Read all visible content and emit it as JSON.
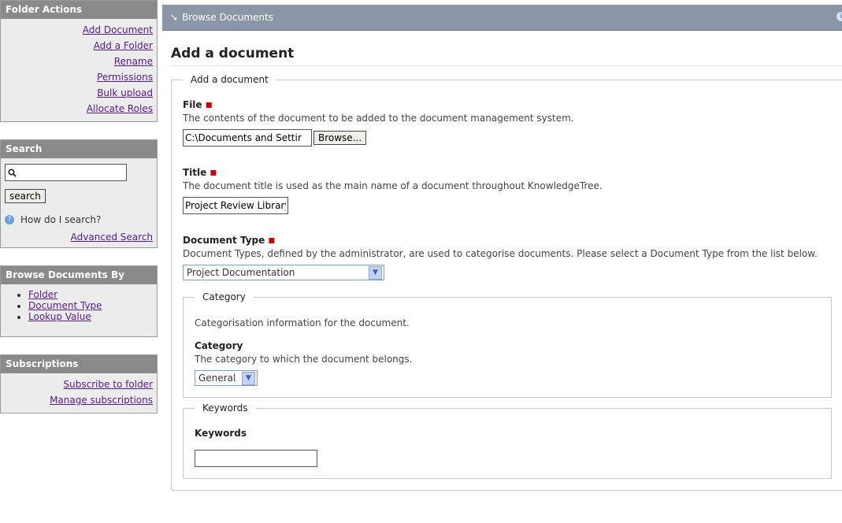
{
  "window": {
    "cut_top_text": "page"
  },
  "sidebar": {
    "folder_actions": {
      "title": "Folder Actions",
      "items": [
        {
          "label": "Add Document"
        },
        {
          "label": "Add a Folder"
        },
        {
          "label": "Rename"
        },
        {
          "label": "Permissions"
        },
        {
          "label": "Bulk upload"
        },
        {
          "label": "Allocate Roles"
        }
      ]
    },
    "search": {
      "title": "Search",
      "input_value": "",
      "button_label": "search",
      "help_text": "How do I search?",
      "advanced_label": "Advanced Search"
    },
    "browse_by": {
      "title": "Browse Documents By",
      "items": [
        {
          "label": "Folder"
        },
        {
          "label": "Document Type"
        },
        {
          "label": "Lookup Value"
        }
      ]
    },
    "subscriptions": {
      "title": "Subscriptions",
      "items": [
        {
          "label": "Subscribe to folder"
        },
        {
          "label": "Manage subscriptions"
        }
      ]
    }
  },
  "header": {
    "breadcrumb": "Browse Documents"
  },
  "main": {
    "page_title": "Add a document",
    "fieldset_legend": "Add a document",
    "file": {
      "label": "File",
      "desc": "The contents of the document to be added to the document management system.",
      "value": "C:\\Documents and Settir",
      "browse_label": "Browse..."
    },
    "title_field": {
      "label": "Title",
      "desc": "The document title is used as the main name of a document throughout KnowledgeTree.",
      "value": "Project Review Library"
    },
    "doc_type": {
      "label": "Document Type",
      "desc": "Document Types, defined by the administrator, are used to categorise documents. Please select a Document Type from the list below.",
      "selected": "Project Documentation"
    },
    "category_set": {
      "legend": "Category",
      "desc": "Categorisation information for the document.",
      "field_label": "Category",
      "field_desc": "The category to which the document belongs.",
      "selected": "General"
    },
    "keywords_set": {
      "legend": "Keywords",
      "field_label": "Keywords"
    }
  },
  "colors": {
    "panel_header": "#8a8a8a",
    "topbar": "#8b97a8",
    "required": "#cc0000",
    "link": "#551a8b"
  }
}
